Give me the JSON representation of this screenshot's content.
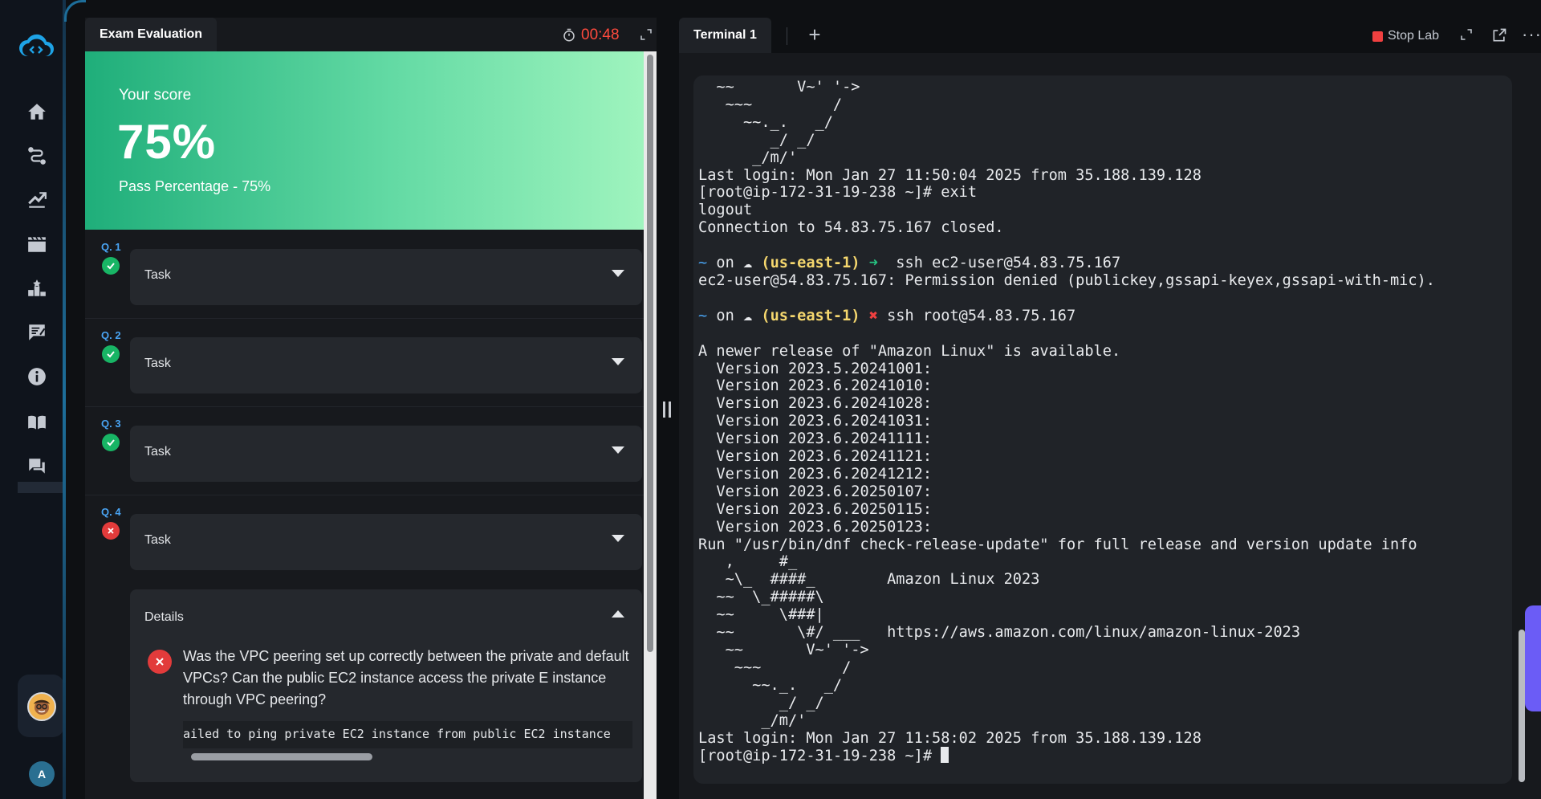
{
  "exam": {
    "tab_title": "Exam Evaluation",
    "timer": "00:48",
    "score_label": "Your score",
    "score_value": "75%",
    "pass_percentage": "Pass Percentage - 75%",
    "questions": [
      {
        "number": "Q. 1",
        "label": "Task",
        "status": "pass"
      },
      {
        "number": "Q. 2",
        "label": "Task",
        "status": "pass"
      },
      {
        "number": "Q. 3",
        "label": "Task",
        "status": "pass"
      },
      {
        "number": "Q. 4",
        "label": "Task",
        "status": "fail"
      }
    ],
    "details": {
      "title": "Details",
      "question": "Was the VPC peering set up correctly between the private and default VPCs? Can the public EC2 instance access the private E instance through VPC peering?",
      "output": "ailed to ping private EC2 instance from public EC2 instance"
    }
  },
  "user": {
    "initial": "A"
  },
  "terminal": {
    "tab_title": "Terminal 1",
    "add_tab": "+",
    "stop_lab": "Stop Lab",
    "more": "···",
    "lines_top": [
      "  ~~       V~' '->",
      "   ~~~         /",
      "     ~~._.   _/",
      "        _/ _/",
      "      _/m/'",
      "Last login: Mon Jan 27 11:50:04 2025 from 35.188.139.128",
      "[root@ip-172-31-19-238 ~]# exit",
      "logout",
      "Connection to 54.83.75.167 closed.",
      ""
    ],
    "prompt1": {
      "tilde": "~",
      "on": " on ☁ ",
      "region": "(us-east-1)",
      "arrow": " ➜ ",
      "cmd": " ssh ec2-user@54.83.75.167"
    },
    "denied": "ec2-user@54.83.75.167: Permission denied (publickey,gssapi-keyex,gssapi-with-mic).",
    "prompt2": {
      "tilde": "~",
      "on": " on ☁ ",
      "region": "(us-east-1)",
      "arrow": " ✖ ",
      "cmd": "ssh root@54.83.75.167"
    },
    "lines_bottom": [
      "",
      "A newer release of \"Amazon Linux\" is available.",
      "  Version 2023.5.20241001:",
      "  Version 2023.6.20241010:",
      "  Version 2023.6.20241028:",
      "  Version 2023.6.20241031:",
      "  Version 2023.6.20241111:",
      "  Version 2023.6.20241121:",
      "  Version 2023.6.20241212:",
      "  Version 2023.6.20250107:",
      "  Version 2023.6.20250115:",
      "  Version 2023.6.20250123:",
      "Run \"/usr/bin/dnf check-release-update\" for full release and version update info",
      "   ,     #_",
      "   ~\\_  ####_        Amazon Linux 2023",
      "  ~~  \\_#####\\",
      "  ~~     \\###|",
      "  ~~       \\#/ ___   https://aws.amazon.com/linux/amazon-linux-2023",
      "   ~~       V~' '->",
      "    ~~~         /",
      "      ~~._.   _/",
      "         _/ _/",
      "       _/m/'",
      "Last login: Mon Jan 27 11:58:02 2025 from 35.188.139.128"
    ],
    "final_prompt": "[root@ip-172-31-19-238 ~]# "
  },
  "icons": [
    "cloud-code-logo",
    "home-icon",
    "route-icon",
    "chart-icon",
    "clapper-icon",
    "leaderboard-icon",
    "feedback-icon",
    "info-icon",
    "book-icon",
    "chat-icon",
    "timer-icon",
    "expand-icon",
    "popout-icon"
  ]
}
